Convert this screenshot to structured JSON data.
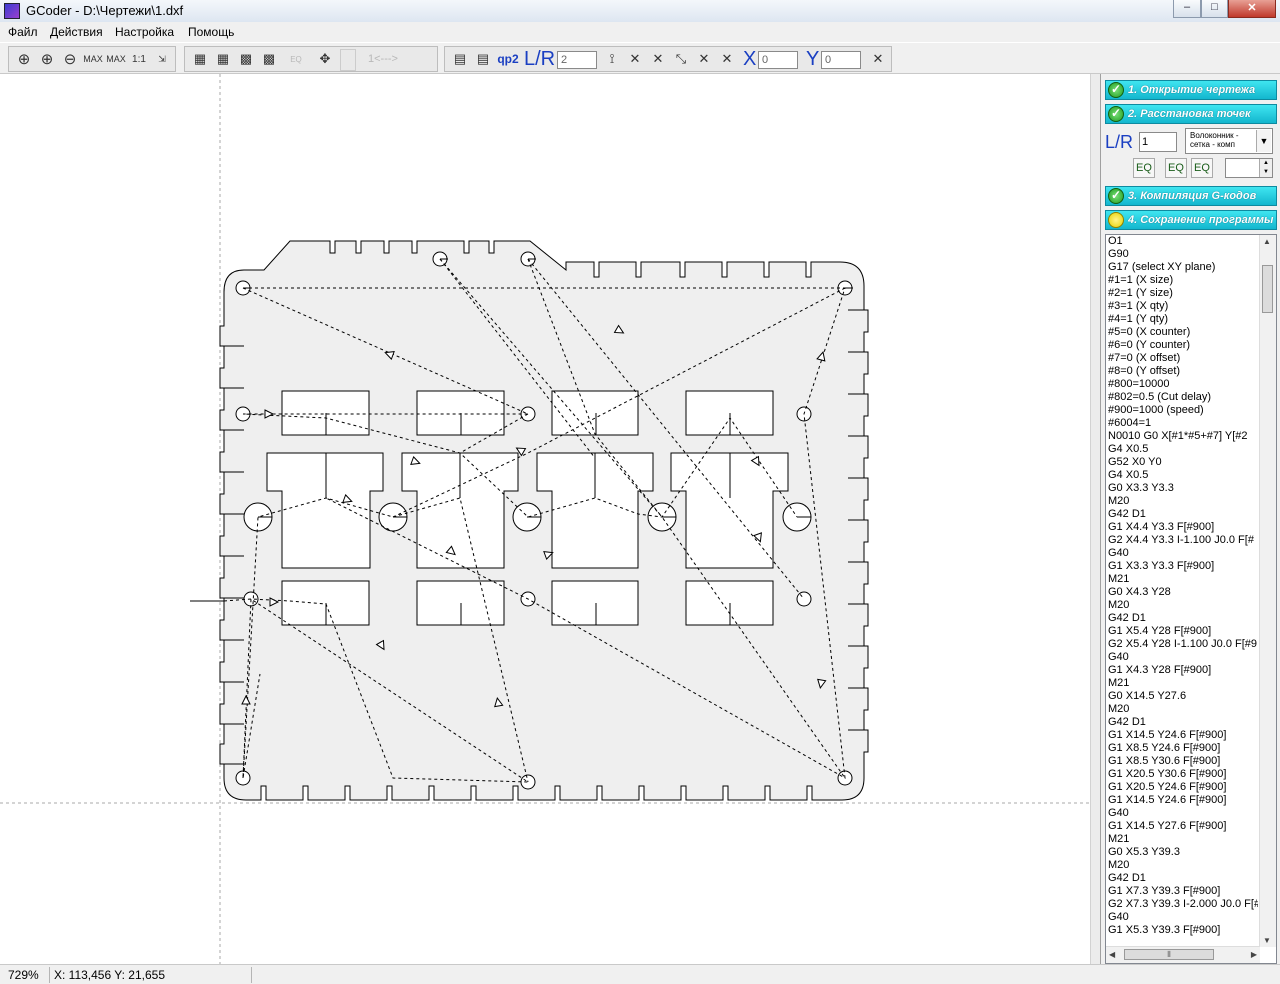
{
  "window": {
    "title": "GCoder - D:\\Чертежи\\1.dxf",
    "controls": [
      "–",
      "□",
      "✕"
    ]
  },
  "menu": [
    {
      "id": "file",
      "label": "Файл"
    },
    {
      "id": "actions",
      "label": "Действия"
    },
    {
      "id": "settings",
      "label": "Настройка"
    },
    {
      "id": "help",
      "label": "Помощь"
    }
  ],
  "toolbar": {
    "zoom_tools": [
      "zoom-window-icon",
      "zoom-in-icon",
      "zoom-out-icon",
      "zoom-max-icon",
      "zoom-max-all-icon",
      "zoom-1to1-icon",
      "zoom-fit-icon"
    ],
    "point_tools": [
      "layer-1-icon",
      "layer-2-icon",
      "layer-3-icon",
      "layer-4-icon",
      "eq-icon",
      "hand-icon"
    ],
    "range_label": "1<--->",
    "qp2_label": "qp2",
    "lr_label": "L/R",
    "lr_value": "2",
    "x_label": "X",
    "x_value": "0",
    "y_label": "Y",
    "y_value": "0"
  },
  "panel": {
    "steps": [
      {
        "label": "1. Открытие чертежа",
        "status": "done"
      },
      {
        "label": "2. Расстановка точек",
        "status": "done"
      },
      {
        "label": "3. Компиляция G-кодов",
        "status": "done"
      },
      {
        "label": "4. Сохранение программы",
        "status": "pending"
      }
    ],
    "lr_label": "L/R",
    "lr_value": "1",
    "mode_select": "Волоконник -\nсетка - комп",
    "eq_buttons": [
      "EQ",
      "EQ",
      "EQ"
    ]
  },
  "code_lines": [
    "O1",
    "G90",
    "G17 (select XY plane)",
    "#1=1 (X size)",
    "#2=1 (Y size)",
    "#3=1 (X qty)",
    "#4=1 (Y qty)",
    "#5=0 (X counter)",
    "#6=0 (Y counter)",
    "#7=0 (X offset)",
    "#8=0 (Y offset)",
    "#800=10000",
    "#802=0.5 (Cut delay)",
    "#900=1000 (speed)",
    "#6004=1",
    "N0010 G0 X[#1*#5+#7] Y[#2",
    "G4 X0.5",
    "G52 X0 Y0",
    "G4 X0.5",
    "G0 X3.3 Y3.3",
    "M20",
    "G42 D1",
    "G1 X4.4 Y3.3 F[#900]",
    "G2 X4.4 Y3.3 I-1.100 J0.0 F[#",
    "G40",
    "G1 X3.3 Y3.3 F[#900]",
    "M21",
    "G0 X4.3 Y28",
    "M20",
    "G42 D1",
    "G1 X5.4 Y28 F[#900]",
    "G2 X5.4 Y28 I-1.100 J0.0 F[#9",
    "G40",
    "G1 X4.3 Y28 F[#900]",
    "M21",
    "G0 X14.5 Y27.6",
    "M20",
    "G42 D1",
    "G1 X14.5 Y24.6 F[#900]",
    "G1 X8.5 Y24.6 F[#900]",
    "G1 X8.5 Y30.6 F[#900]",
    "G1 X20.5 Y30.6 F[#900]",
    "G1 X20.5 Y24.6 F[#900]",
    "G1 X14.5 Y24.6 F[#900]",
    "G40",
    "G1 X14.5 Y27.6 F[#900]",
    "M21",
    "G0 X5.3 Y39.3",
    "M20",
    "G42 D1",
    "G1 X7.3 Y39.3 F[#900]",
    "G2 X7.3 Y39.3 I-2.000 J0.0 F[#",
    "G40",
    "G1 X5.3 Y39.3 F[#900]"
  ],
  "status": {
    "zoom": "729%",
    "coords": "X: 113,456 Y: 21,655"
  }
}
